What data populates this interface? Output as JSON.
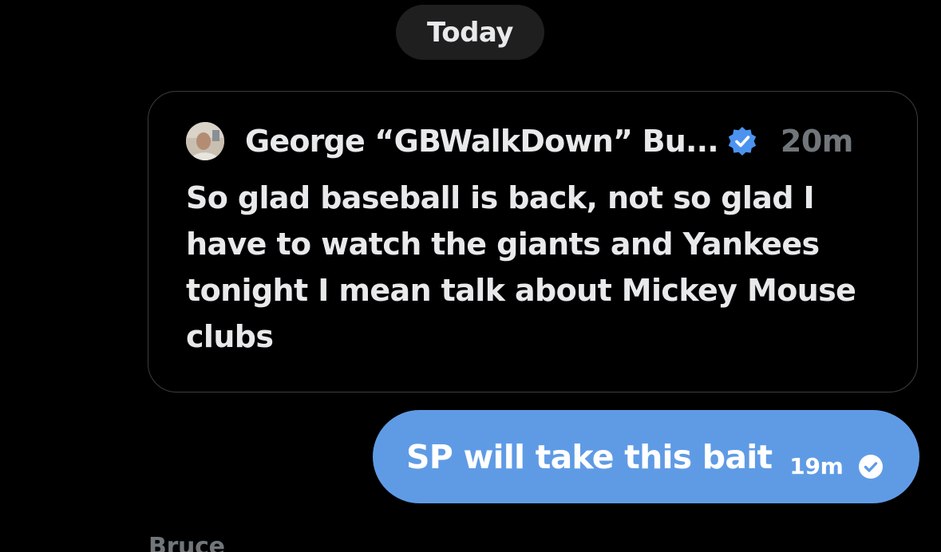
{
  "conversation": {
    "date_separator": "Today",
    "quoted_post": {
      "author_display_name": "George “GBWalkDown” Bu...",
      "verified_icon": "verified-badge-icon",
      "time_ago": "20m",
      "text": "So glad baseball is back, not so glad I have to watch the giants and Yankees tonight I mean talk about Mickey Mouse clubs"
    },
    "sent_message": {
      "text": "SP will take this bait",
      "time_ago": "19m",
      "status_icon": "read-check-icon"
    },
    "next_sender_label": "Bruce"
  },
  "colors": {
    "background": "#000000",
    "date_pill": "#1f1f1f",
    "bubble": "#5f9be5",
    "verified_blue": "#4c93f0",
    "muted_text": "#71767b",
    "primary_text": "#e7e9ea"
  }
}
